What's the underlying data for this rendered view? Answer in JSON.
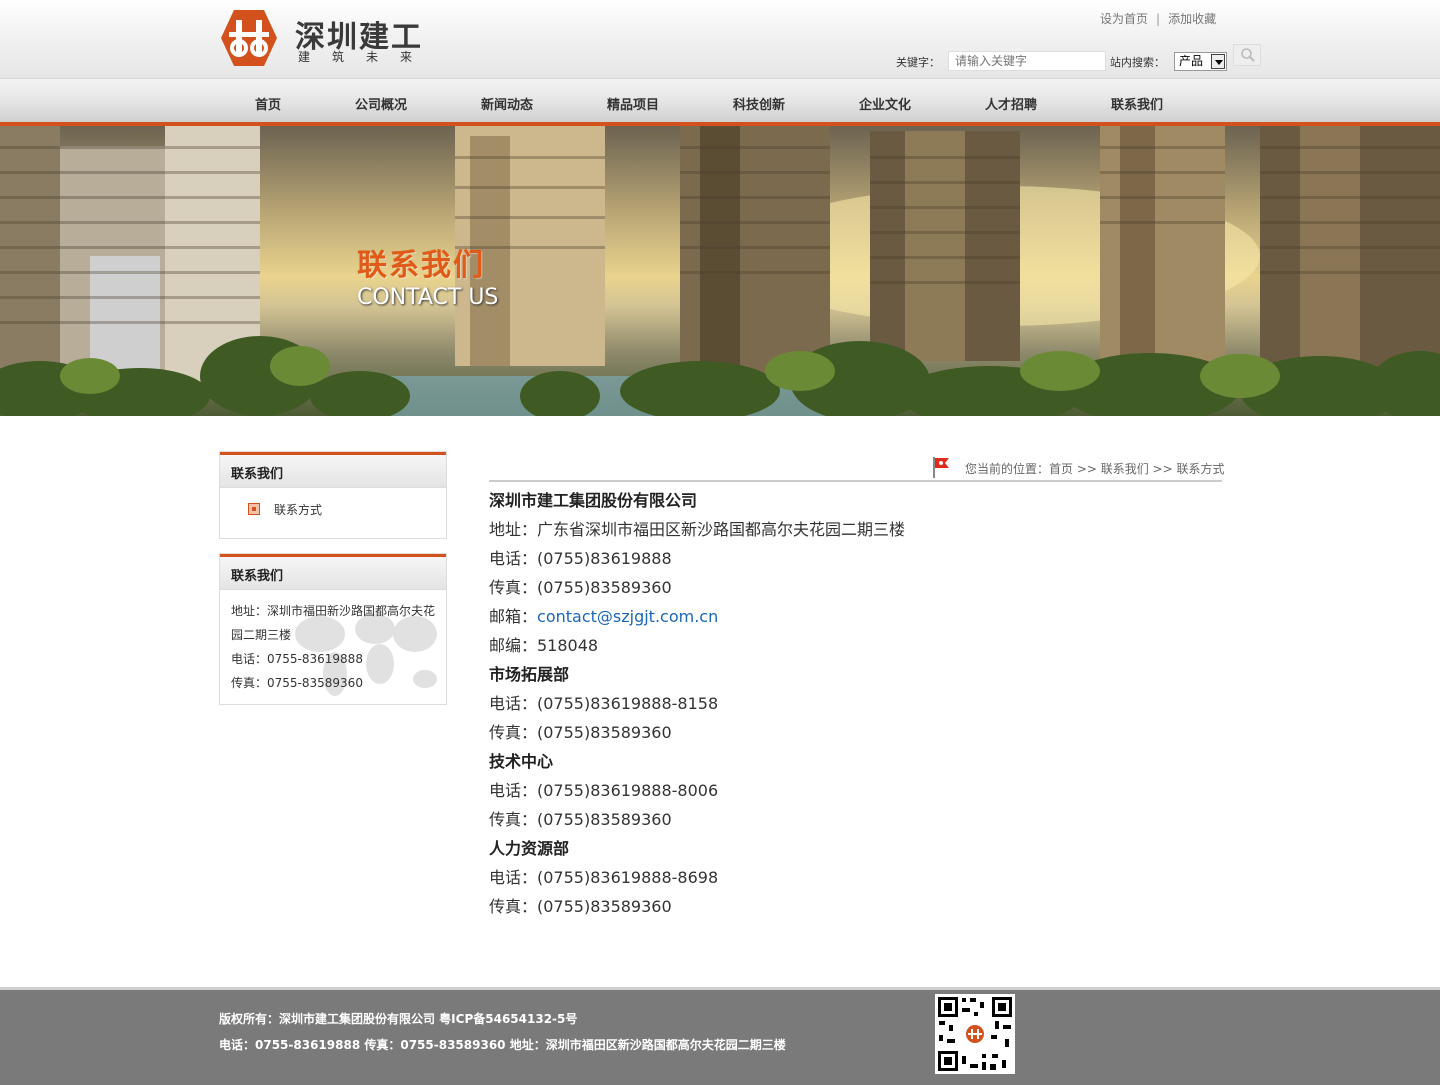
{
  "brand": {
    "name": "深圳建工",
    "sub": "建筑未来",
    "accent": "#d2511c"
  },
  "top_links": [
    "设为首页",
    "添加收藏"
  ],
  "search": {
    "keyword_label": "关键字：",
    "placeholder": "请输入关键字",
    "scope_label": "站内搜索：",
    "scope_value": "产品"
  },
  "nav": [
    "首页",
    "公司概况",
    "新闻动态",
    "精品项目",
    "科技创新",
    "企业文化",
    "人才招聘",
    "联系我们"
  ],
  "banner": {
    "title": "联系我们",
    "subtitle": "CONTACT US"
  },
  "sidebar": {
    "menu_title": "联系我们",
    "menu_items": [
      "联系方式"
    ],
    "contact_title": "联系我们",
    "contact_lines": [
      "地址：深圳市福田新沙路国都高尔夫花园二期三楼",
      "电话：0755-83619888",
      "传真：0755-83589360"
    ]
  },
  "breadcrumb": "您当前的位置：首页 >> 联系我们 >> 联系方式",
  "content": {
    "company": "深圳市建工集团股份有限公司",
    "address": "地址：广东省深圳市福田区新沙路国都高尔夫花园二期三楼",
    "phone": "电话：(0755)83619888",
    "fax": "传真：(0755)83589360",
    "email_label": "邮箱：",
    "email": "contact@szjgjt.com.cn",
    "postcode": "邮编：518048",
    "departments": [
      {
        "name": "市场拓展部",
        "phone": "电话：(0755)83619888-8158",
        "fax": "传真：(0755)83589360"
      },
      {
        "name": "技术中心",
        "phone": "电话：(0755)83619888-8006",
        "fax": "传真：(0755)83589360"
      },
      {
        "name": "人力资源部",
        "phone": "电话：(0755)83619888-8698",
        "fax": "传真：(0755)83589360"
      }
    ]
  },
  "footer": {
    "line1": "版权所有：深圳市建工集团股份有限公司 粤ICP备54654132-5号",
    "line2": "电话：0755-83619888 传真：0755-83589360 地址：深圳市福田区新沙路国都高尔夫花园二期三楼"
  }
}
